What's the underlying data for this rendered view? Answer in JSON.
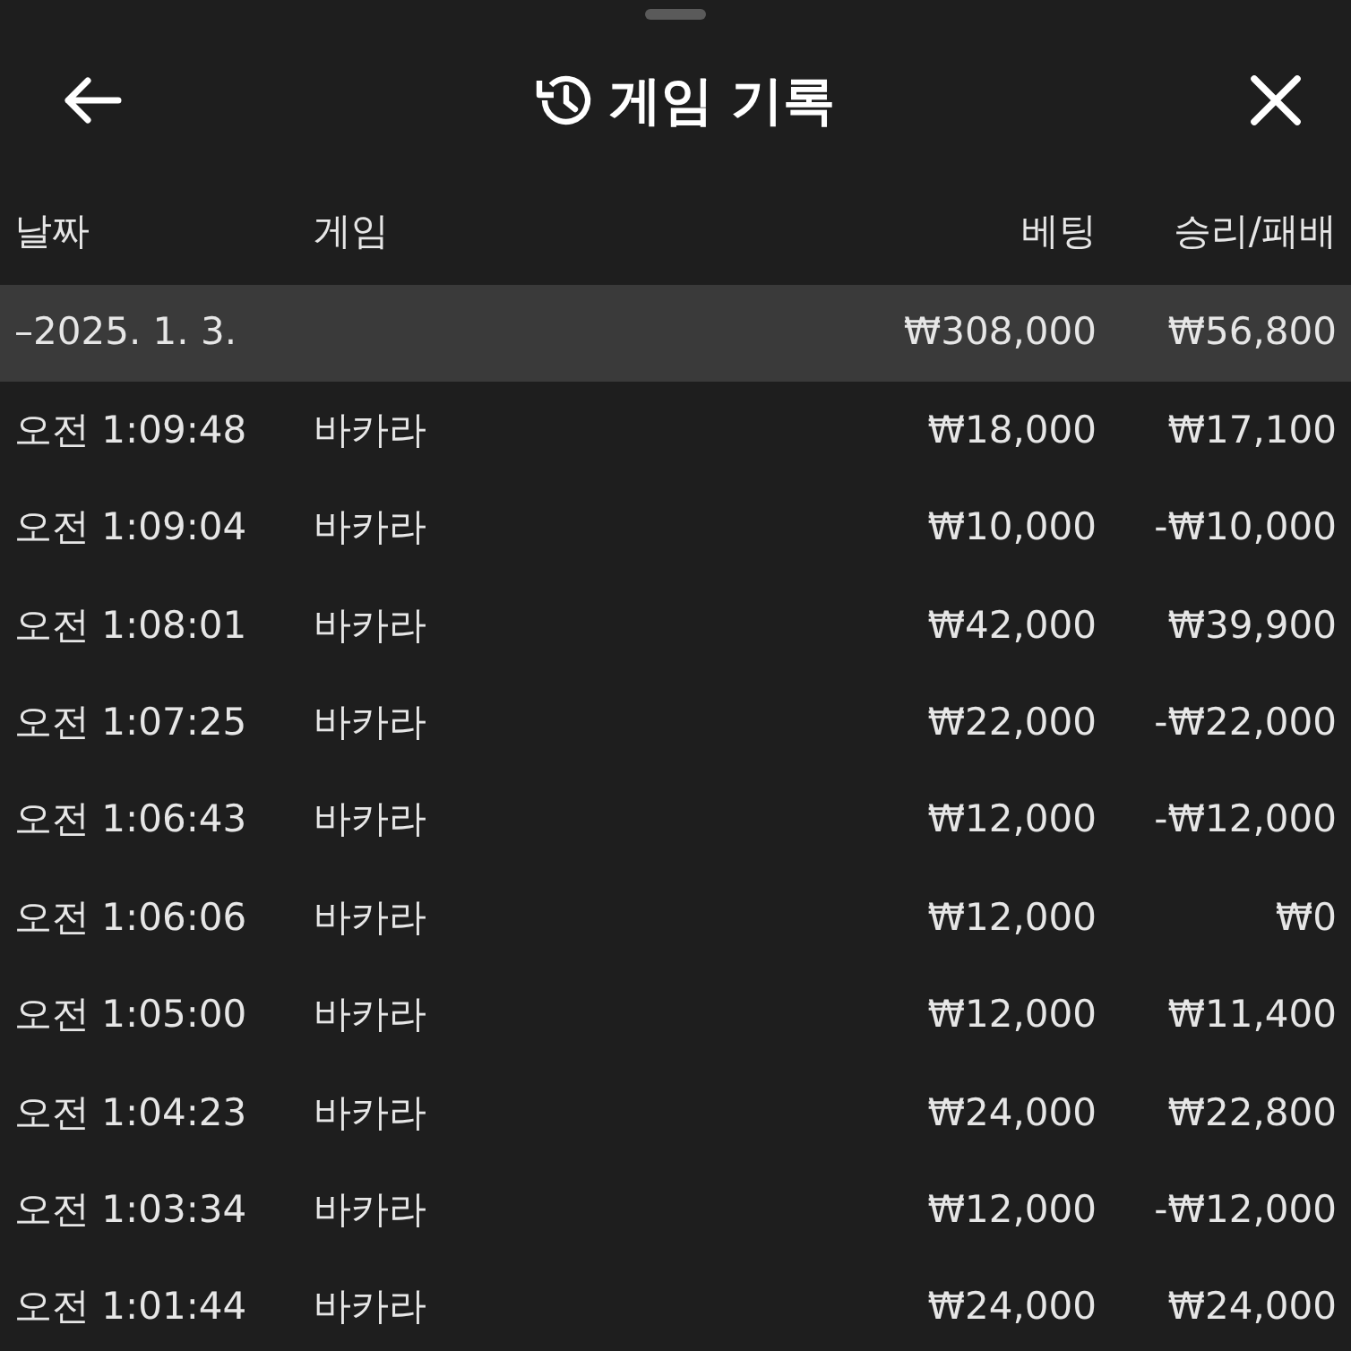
{
  "header": {
    "title": "게임 기록"
  },
  "table": {
    "columns": [
      "날짜",
      "게임",
      "베팅",
      "승리/패배"
    ],
    "summary": {
      "date": "–2025. 1. 3.",
      "bet": "₩308,000",
      "result": "₩56,800"
    },
    "rows": [
      {
        "time": "오전 1:09:48",
        "game": "바카라",
        "bet": "₩18,000",
        "result": "₩17,100"
      },
      {
        "time": "오전 1:09:04",
        "game": "바카라",
        "bet": "₩10,000",
        "result": "-₩10,000"
      },
      {
        "time": "오전 1:08:01",
        "game": "바카라",
        "bet": "₩42,000",
        "result": "₩39,900"
      },
      {
        "time": "오전 1:07:25",
        "game": "바카라",
        "bet": "₩22,000",
        "result": "-₩22,000"
      },
      {
        "time": "오전 1:06:43",
        "game": "바카라",
        "bet": "₩12,000",
        "result": "-₩12,000"
      },
      {
        "time": "오전 1:06:06",
        "game": "바카라",
        "bet": "₩12,000",
        "result": "₩0"
      },
      {
        "time": "오전 1:05:00",
        "game": "바카라",
        "bet": "₩12,000",
        "result": "₩11,400"
      },
      {
        "time": "오전 1:04:23",
        "game": "바카라",
        "bet": "₩24,000",
        "result": "₩22,800"
      },
      {
        "time": "오전 1:03:34",
        "game": "바카라",
        "bet": "₩12,000",
        "result": "-₩12,000"
      },
      {
        "time": "오전 1:01:44",
        "game": "바카라",
        "bet": "₩24,000",
        "result": "₩24,000"
      }
    ]
  }
}
